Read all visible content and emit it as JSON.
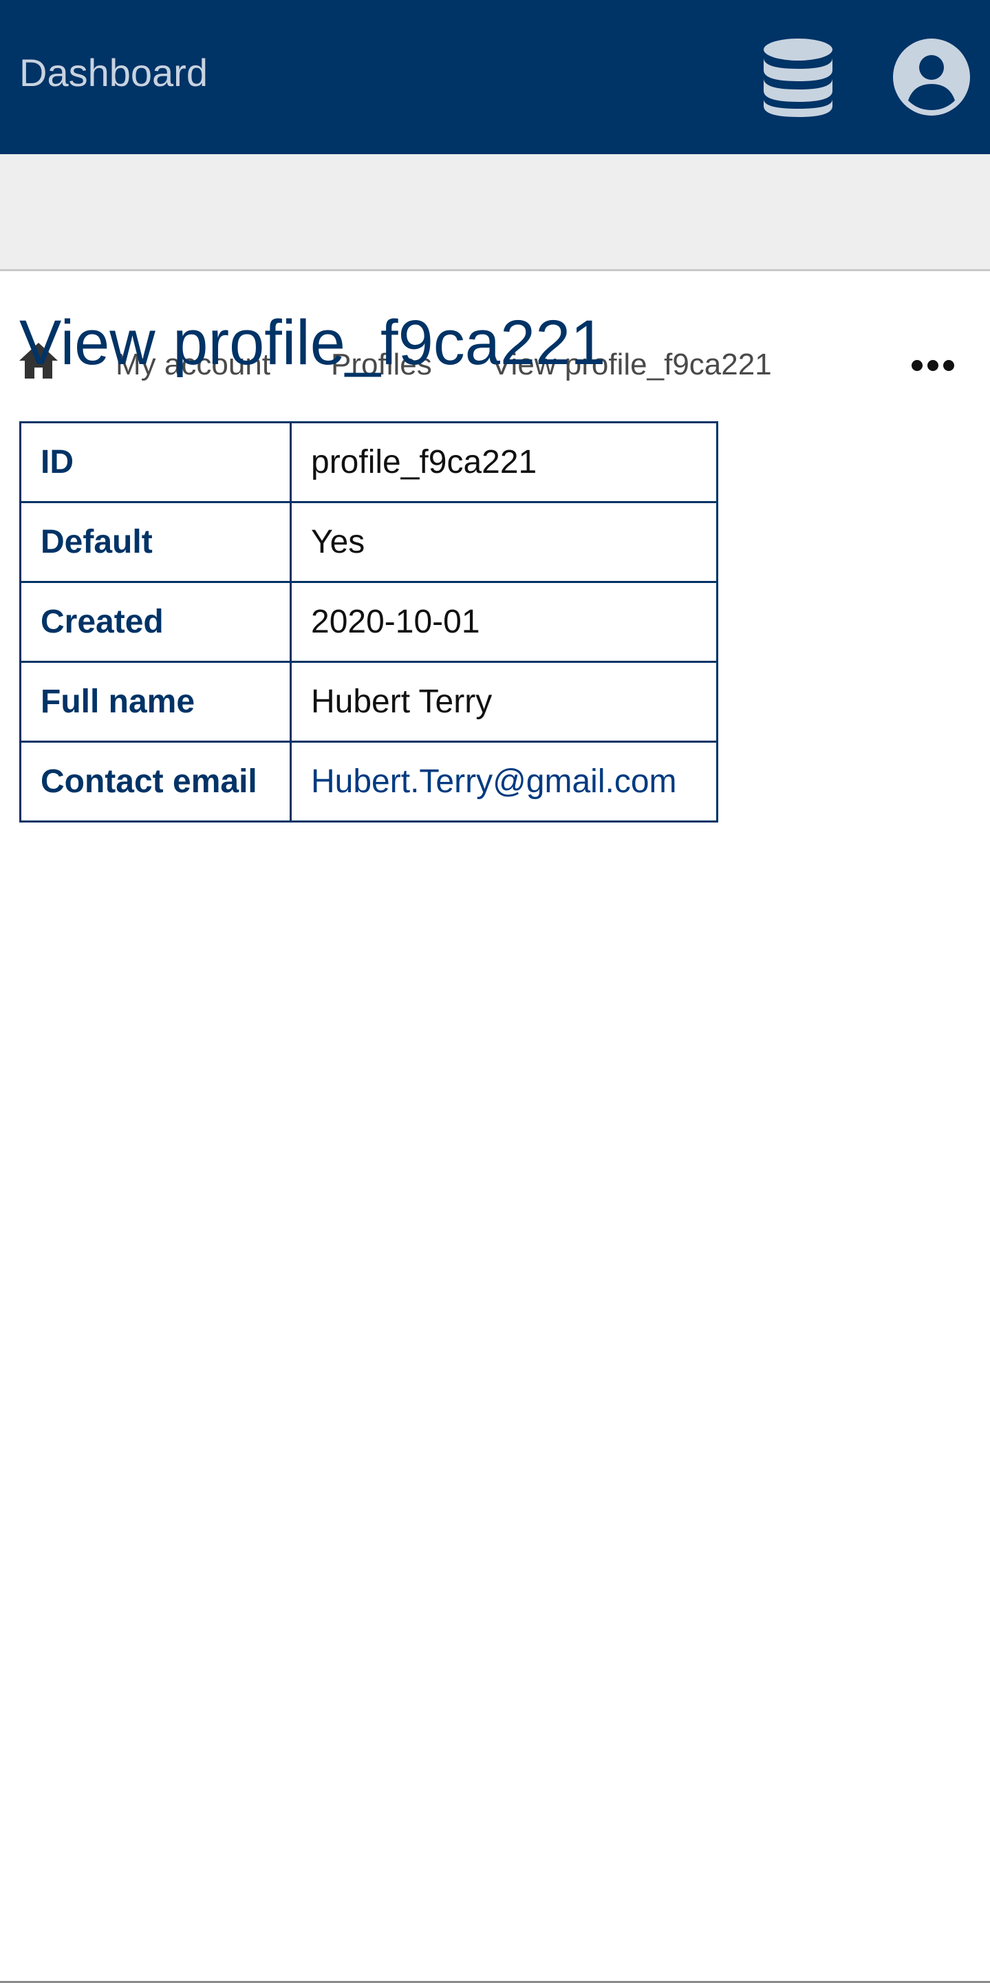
{
  "header": {
    "brand": "Dashboard",
    "icons": [
      "database-icon",
      "user-account-icon"
    ],
    "background_color": "#003366"
  },
  "breadcrumb": {
    "home_icon": "home-icon",
    "items": [
      {
        "label": "My account"
      },
      {
        "label": "Profiles"
      },
      {
        "label": "View profile_f9ca221"
      }
    ],
    "more_icon": "ellipsis-icon"
  },
  "page": {
    "title": "View profile_f9ca221"
  },
  "details": {
    "rows": [
      {
        "key": "ID",
        "value": "profile_f9ca221"
      },
      {
        "key": "Default",
        "value": "Yes"
      },
      {
        "key": "Created",
        "value": "2020-10-01"
      },
      {
        "key": "Full name",
        "value": "Hubert Terry"
      },
      {
        "key": "Contact email",
        "value": "Hubert.Terry@gmail.com"
      }
    ]
  },
  "colors": {
    "accent": "#003366",
    "link": "#003a80",
    "breadcrumb_bg": "#eeeeee"
  }
}
